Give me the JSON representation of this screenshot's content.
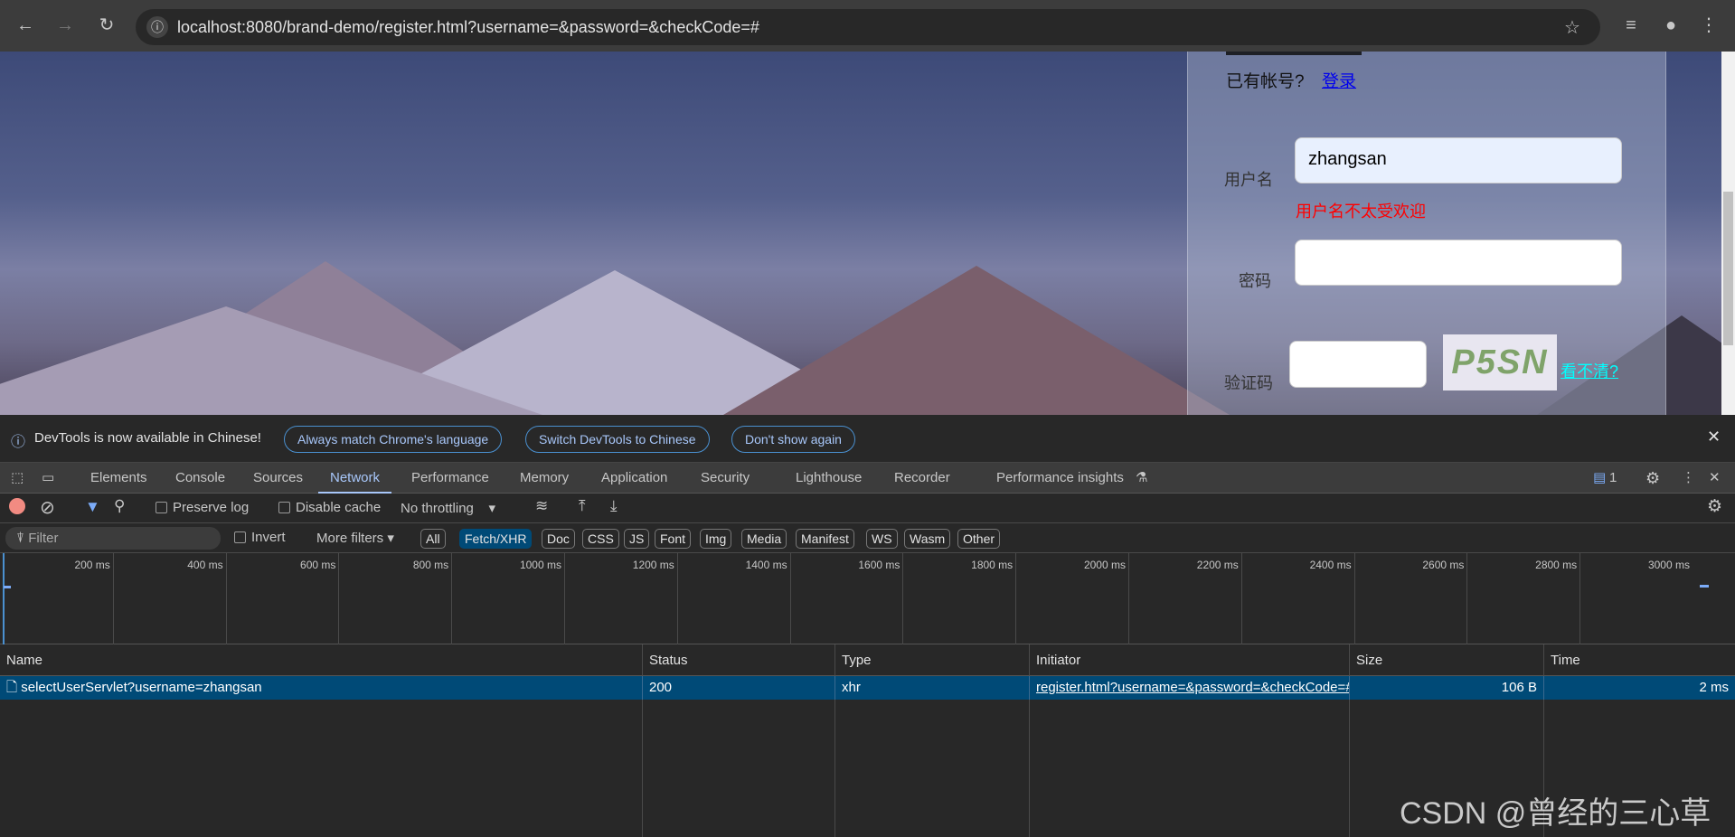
{
  "browser": {
    "url": "localhost:8080/brand-demo/register.html?username=&password=&checkCode=#",
    "icons": [
      "back-icon",
      "forward-icon",
      "reload-icon",
      "info-icon",
      "star-icon",
      "media-icon",
      "profile-icon",
      "menu-icon"
    ]
  },
  "form": {
    "has_account": "已有帐号?",
    "login_link": "登录",
    "username_label": "用户名",
    "username_value": "zhangsan",
    "username_error": "用户名不太受欢迎",
    "password_label": "密码",
    "password_value": "",
    "checkcode_label": "验证码",
    "checkcode_value": "",
    "captcha_text": "P5SN",
    "refresh_link": "看不清?",
    "colors": {
      "error": "#ff0000",
      "refresh_link": "#00ffff",
      "login_link": "#0000ee"
    }
  },
  "infobar": {
    "message": "DevTools is now available in Chinese!",
    "buttons": [
      "Always match Chrome's language",
      "Switch DevTools to Chinese",
      "Don't show again"
    ]
  },
  "devtools": {
    "tabs": [
      "Elements",
      "Console",
      "Sources",
      "Network",
      "Performance",
      "Memory",
      "Application",
      "Security",
      "Lighthouse",
      "Recorder",
      "Performance insights"
    ],
    "active_tab": "Network",
    "issues_count": "1",
    "toolbar": {
      "preserve_log": "Preserve log",
      "disable_cache": "Disable cache",
      "throttling": "No throttling"
    },
    "filter": {
      "placeholder": "Filter",
      "invert": "Invert",
      "more_filters": "More filters",
      "types": [
        "All",
        "Fetch/XHR",
        "Doc",
        "CSS",
        "JS",
        "Font",
        "Img",
        "Media",
        "Manifest",
        "WS",
        "Wasm",
        "Other"
      ],
      "active_type": "Fetch/XHR"
    },
    "timeline_ticks": [
      "200 ms",
      "400 ms",
      "600 ms",
      "800 ms",
      "1000 ms",
      "1200 ms",
      "1400 ms",
      "1600 ms",
      "1800 ms",
      "2000 ms",
      "2200 ms",
      "2400 ms",
      "2600 ms",
      "2800 ms",
      "3000 ms"
    ],
    "columns": [
      "Name",
      "Status",
      "Type",
      "Initiator",
      "Size",
      "Time"
    ],
    "rows": [
      {
        "name": "selectUserServlet?username=zhangsan",
        "status": "200",
        "type": "xhr",
        "initiator": "register.html?username=&password=&checkCode=#",
        "size": "106 B",
        "time": "2 ms"
      }
    ]
  },
  "watermark": "CSDN @曾经的三心草"
}
